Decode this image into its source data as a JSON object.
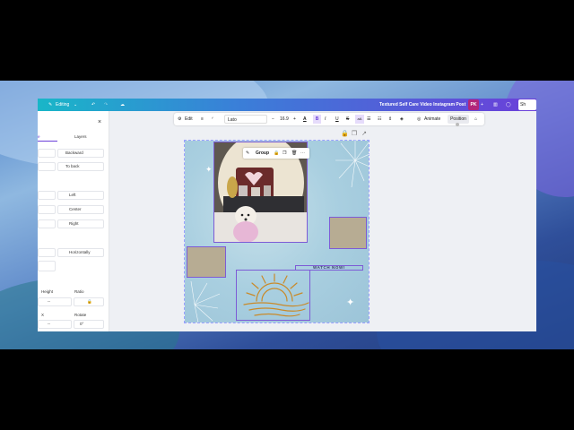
{
  "topbar": {
    "editing": "Editing",
    "title": "Textured Self Care Video Instagram Post",
    "avatar": "PK",
    "share": "Sh"
  },
  "panel": {
    "tab_arrange": "e",
    "tab_layers": "Layers",
    "backward": "Backward",
    "to_back": "To back",
    "left": "Left",
    "center": "Center",
    "right": "Right",
    "horizontally": "Horizontally",
    "height": "Height",
    "ratio": "Ratio",
    "rotate": "Rotate",
    "height_value": "--",
    "rotate_value": "0°"
  },
  "toolbar": {
    "edit": "Edit",
    "font": "Lato",
    "size": "16.9",
    "animate": "Animate",
    "position": "Position"
  },
  "canvas": {
    "group": "Group",
    "watch_now": "WATCH NOW!"
  }
}
